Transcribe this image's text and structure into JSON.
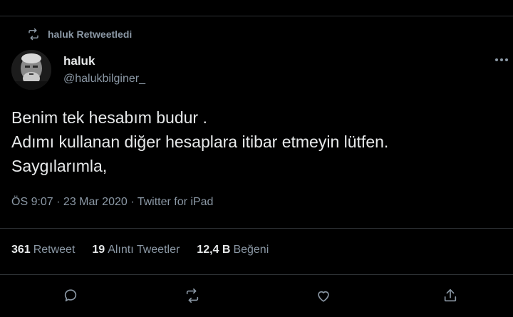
{
  "retweet": {
    "icon": "retweet-icon",
    "label": "haluk Retweetledi"
  },
  "author": {
    "name": "haluk",
    "handle": "@halukbilginer_",
    "avatar": "avatar-photo"
  },
  "tweet": {
    "lines": [
      "Benim tek hesabım budur .",
      "Adımı kullanan diğer hesaplara itibar etmeyin lütfen.",
      "Saygılarımla,"
    ],
    "meta": "ÖS 9:07 · 23 Mar 2020 · Twitter for iPad"
  },
  "stats": {
    "retweets_count": "361",
    "retweets_label": "Retweet",
    "quotes_count": "19",
    "quotes_label": "Alıntı Tweetler",
    "likes_count": "12,4 B",
    "likes_label": "Beğeni"
  },
  "actions": [
    "reply-icon",
    "retweet-icon",
    "like-icon",
    "share-icon"
  ],
  "colors": {
    "background": "#000000",
    "text": "#e7e9ea",
    "secondary": "#8b98a5",
    "divider": "#2f3336"
  }
}
